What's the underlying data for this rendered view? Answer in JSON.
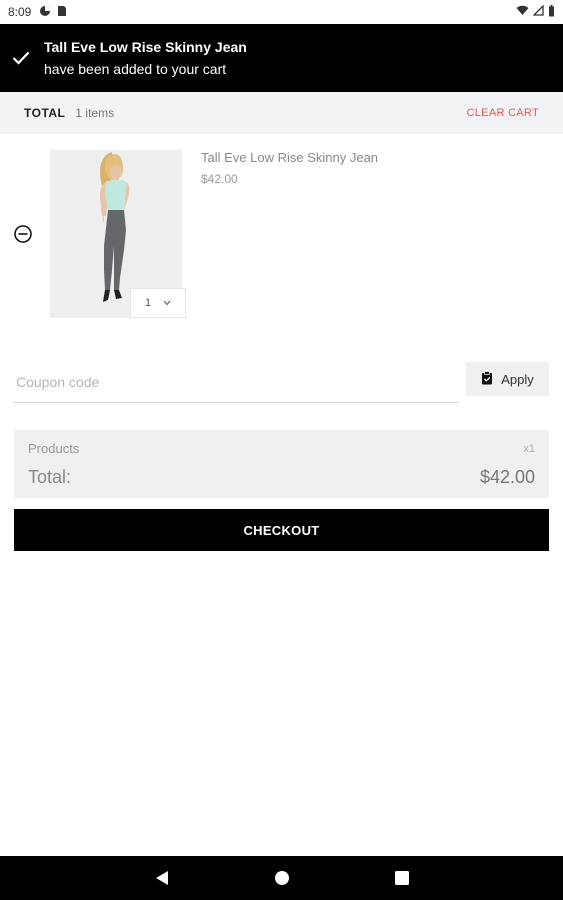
{
  "status_bar": {
    "time": "8:09"
  },
  "toast": {
    "title": "Tall Eve Low Rise Skinny Jean",
    "message": "have been added to your cart"
  },
  "summary": {
    "total_label": "TOTAL",
    "item_count": "1 items",
    "clear_label": "CLEAR CART"
  },
  "cart": {
    "items": [
      {
        "name": "Tall Eve Low Rise Skinny Jean",
        "price": "$42.00",
        "quantity": "1"
      }
    ]
  },
  "coupon": {
    "placeholder": "Coupon code",
    "apply_label": "Apply"
  },
  "totals": {
    "products_label": "Products",
    "products_count": "x1",
    "total_label": "Total:",
    "total_value": "$42.00"
  },
  "checkout_label": "CHECKOUT",
  "colors": {
    "accent": "#ef5350",
    "dark": "#000000",
    "panel": "#eef0f2"
  }
}
